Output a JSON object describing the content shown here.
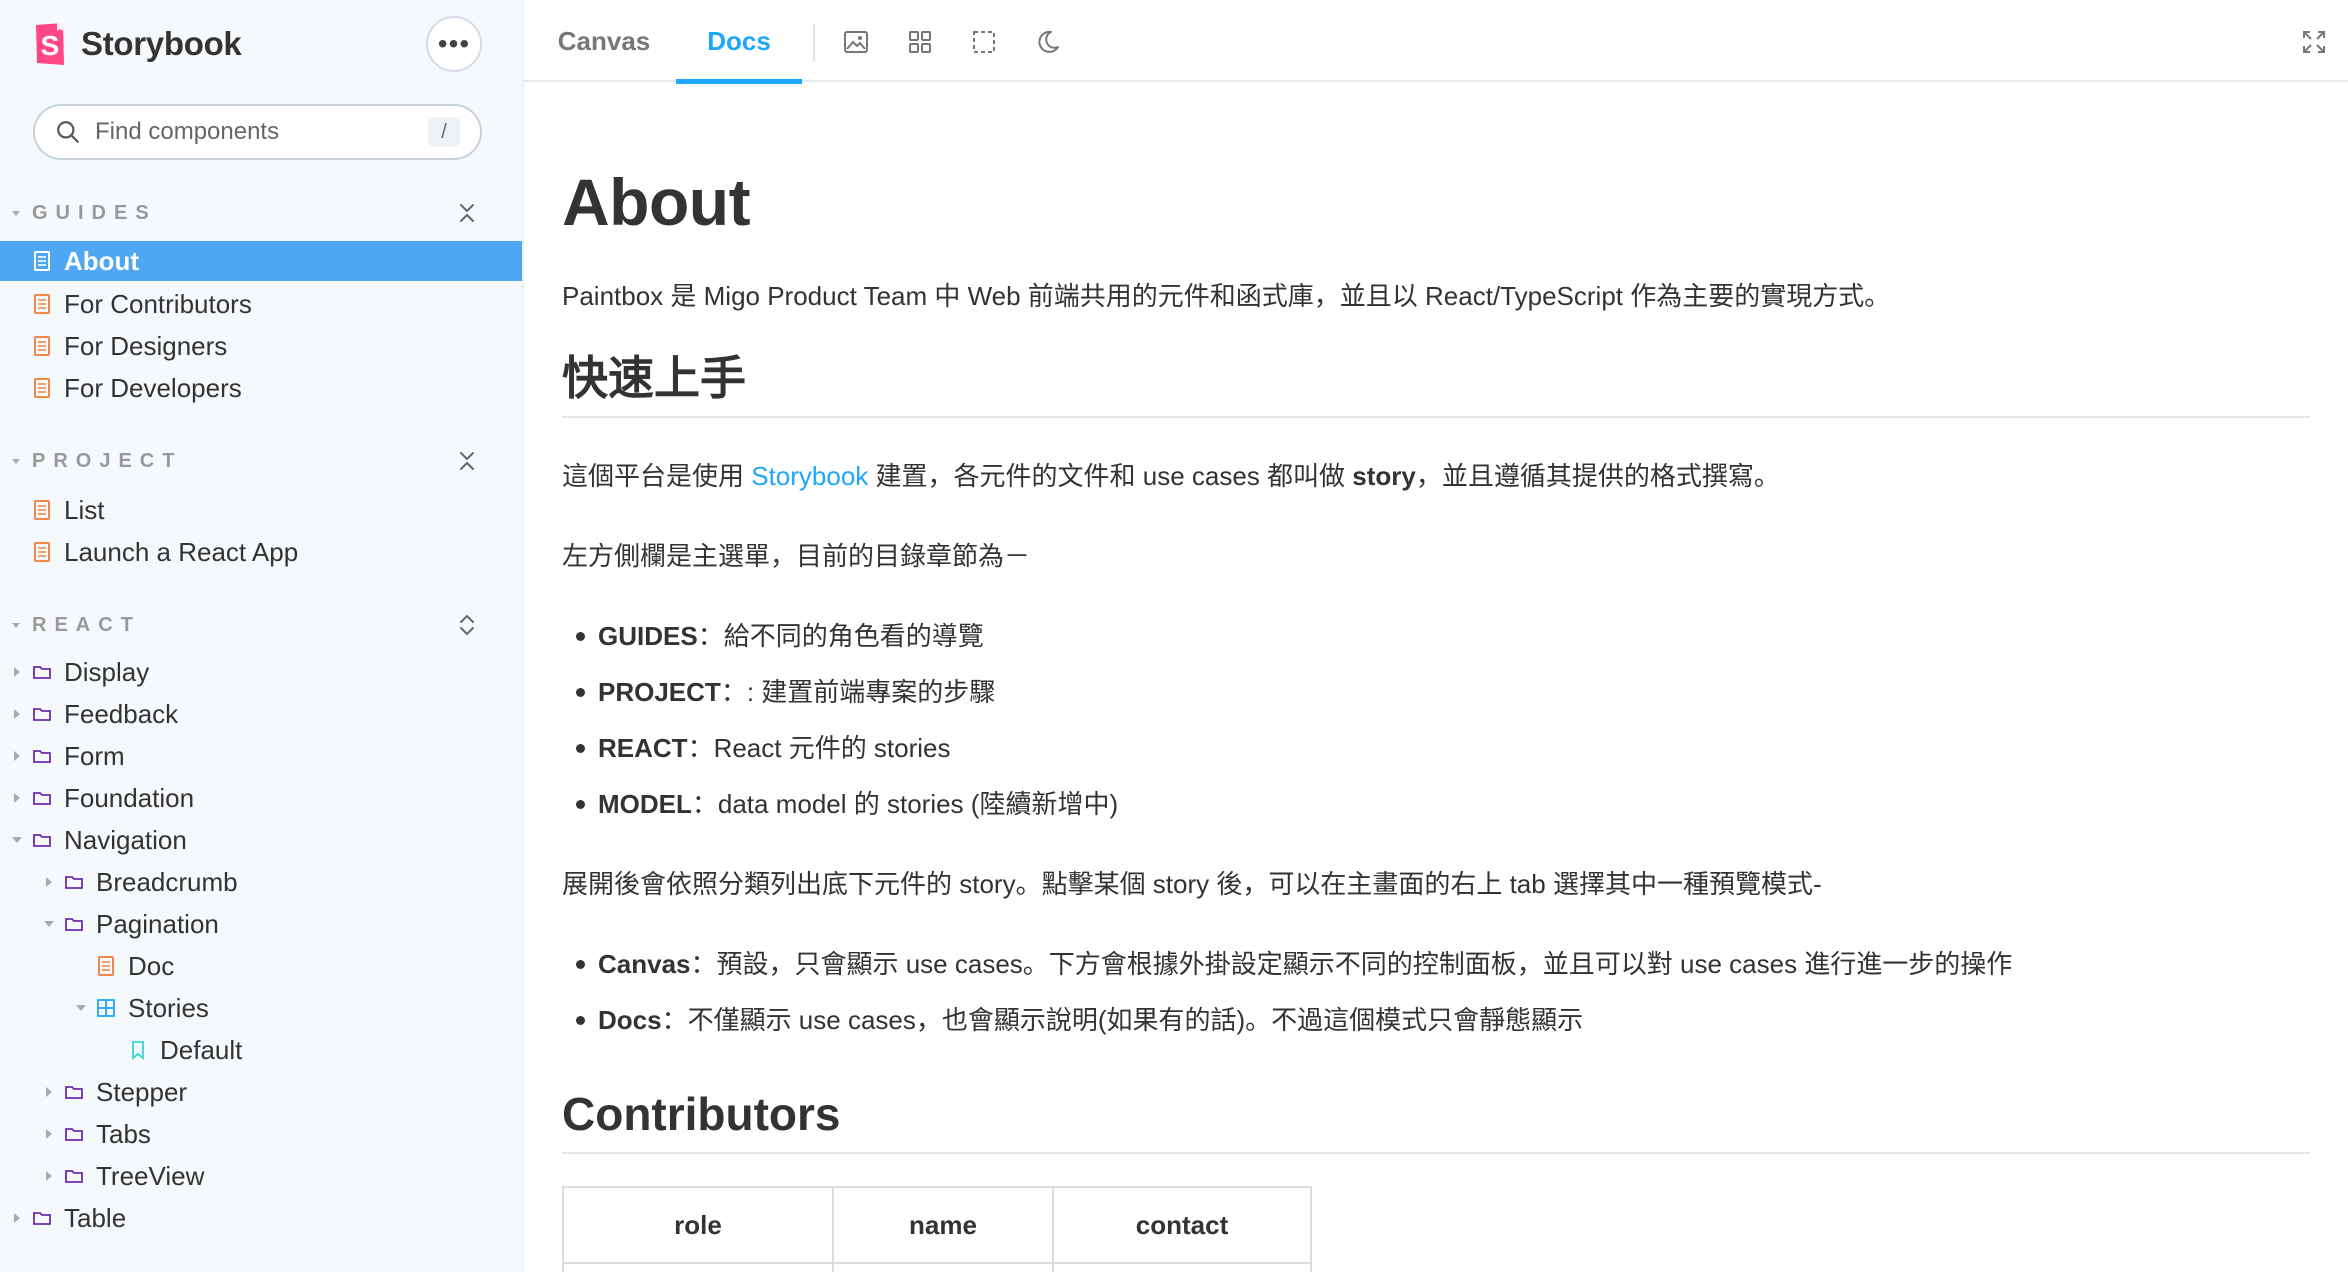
{
  "brand": {
    "logo_letter": "S",
    "name": "Storybook",
    "accent": "#ff4785"
  },
  "menu": {
    "label": "•••"
  },
  "search": {
    "placeholder": "Find components",
    "shortcut": "/"
  },
  "sidebar": {
    "sections": [
      {
        "title": "GUIDES",
        "items": [
          "About",
          "For Contributors",
          "For Designers",
          "For Developers"
        ]
      },
      {
        "title": "PROJECT",
        "items": [
          "List",
          "Launch a React App"
        ]
      },
      {
        "title": "REACT",
        "items": [
          "Display",
          "Feedback",
          "Form",
          "Foundation",
          "Navigation",
          "Breadcrumb",
          "Pagination",
          "Doc",
          "Stories",
          "Default",
          "Stepper",
          "Tabs",
          "TreeView",
          "Table"
        ]
      }
    ],
    "active_item": "About",
    "active_color": "#4fa6f3"
  },
  "toolbar": {
    "tabs": [
      "Canvas",
      "Docs"
    ],
    "active_tab": "Docs",
    "tools": [
      "image-icon",
      "grid-icon",
      "outline-icon",
      "moon-icon"
    ],
    "fullscreen": "expand-icon"
  },
  "doc": {
    "title": "About",
    "intro": "Paintbox 是 Migo Product Team 中 Web 前端共用的元件和函式庫，並且以 React/TypeScript 作為主要的實現方式。",
    "quickstart_heading": "快速上手",
    "p1_before": "這個平台是使用 ",
    "p1_link": "Storybook",
    "p1_middle": " 建置，各元件的文件和 use cases 都叫做 ",
    "p1_bold": "story",
    "p1_after": "，並且遵循其提供的格式撰寫。",
    "p2": "左方側欄是主選單，目前的目錄章節為－",
    "menu_list": [
      {
        "term": "GUIDES",
        "desc": "：給不同的角色看的導覽"
      },
      {
        "term": "PROJECT",
        "desc": "：: 建置前端專案的步驟"
      },
      {
        "term": "REACT",
        "desc": "：React 元件的 stories"
      },
      {
        "term": "MODEL",
        "desc": "：data model 的 stories (陸續新增中)"
      }
    ],
    "p3": "展開後會依照分類列出底下元件的 story。點擊某個 story 後，可以在主畫面的右上 tab 選擇其中一種預覽模式-",
    "mode_list": [
      {
        "term": "Canvas",
        "desc": "：預設，只會顯示 use cases。下方會根據外掛設定顯示不同的控制面板，並且可以對 use cases 進行進一步的操作"
      },
      {
        "term": "Docs",
        "desc": "：不僅顯示 use cases，也會顯示說明(如果有的話)。不過這個模式只會靜態顯示"
      }
    ],
    "contributors_heading": "Contributors",
    "table_headers": [
      "role",
      "name",
      "contact"
    ]
  }
}
